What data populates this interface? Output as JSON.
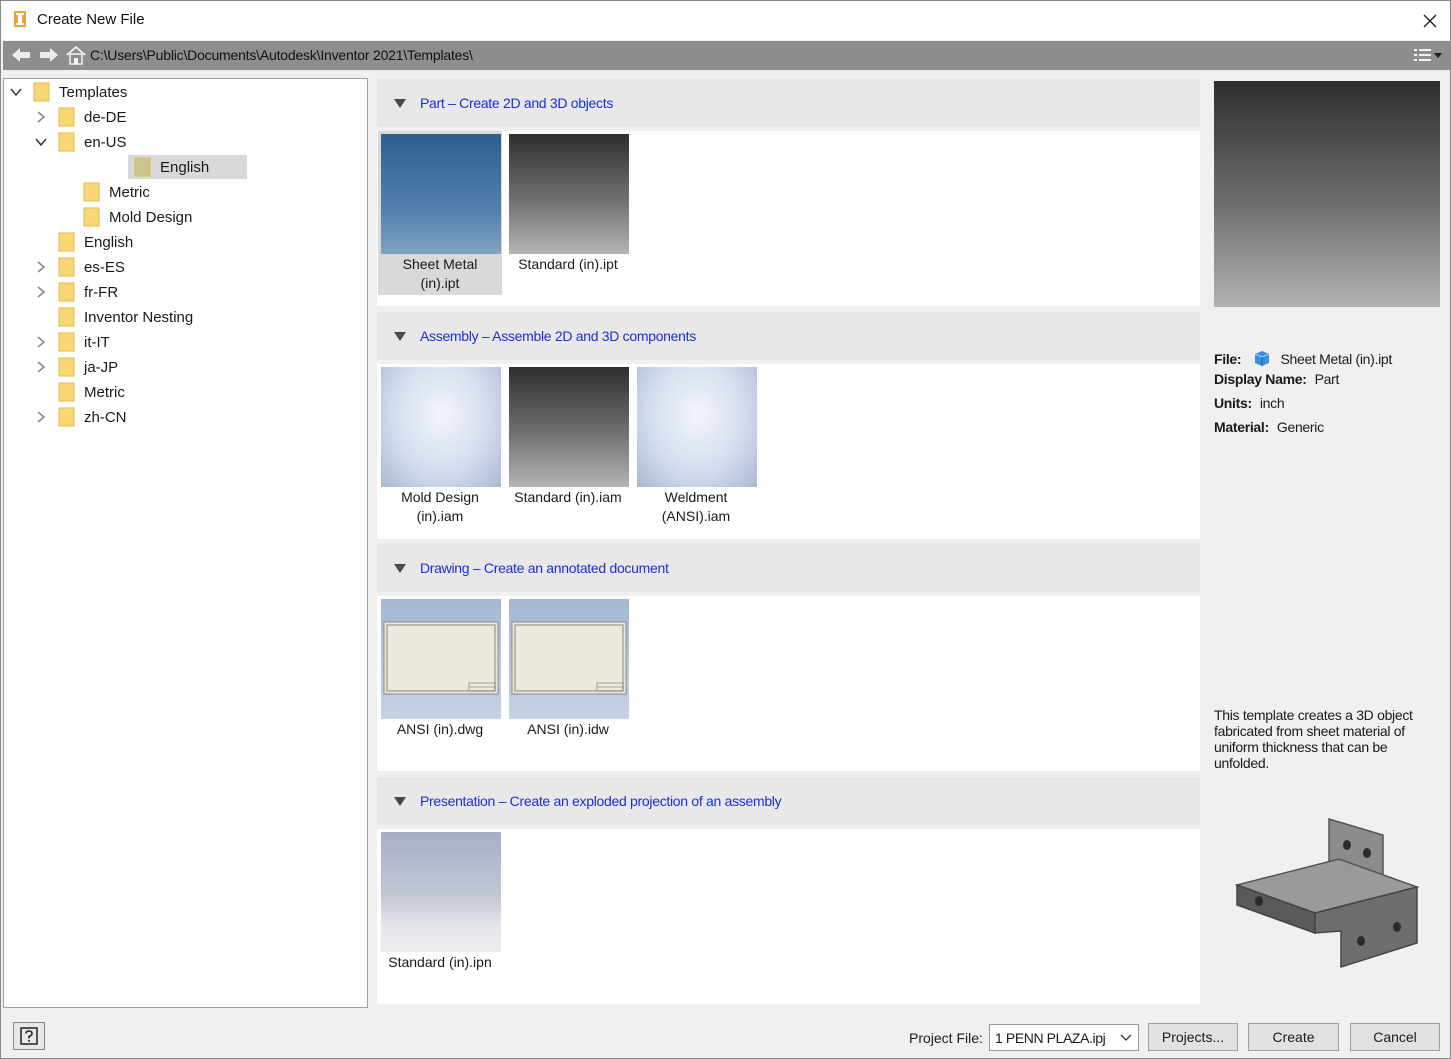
{
  "window": {
    "title": "Create New File"
  },
  "pathbar": {
    "path": "C:\\Users\\Public\\Documents\\Autodesk\\Inventor 2021\\Templates\\"
  },
  "tree": {
    "items": [
      {
        "label": "Templates",
        "expander": "expanded"
      },
      {
        "label": "de-DE",
        "expander": "collapsed"
      },
      {
        "label": "en-US",
        "expander": "expanded"
      },
      {
        "label": "English",
        "expander": "none",
        "selected": true
      },
      {
        "label": "Metric",
        "expander": "none"
      },
      {
        "label": "Mold Design",
        "expander": "none"
      },
      {
        "label": "English",
        "expander": "none"
      },
      {
        "label": "es-ES",
        "expander": "collapsed"
      },
      {
        "label": "fr-FR",
        "expander": "collapsed"
      },
      {
        "label": "Inventor Nesting",
        "expander": "none"
      },
      {
        "label": "it-IT",
        "expander": "collapsed"
      },
      {
        "label": "ja-JP",
        "expander": "collapsed"
      },
      {
        "label": "Metric",
        "expander": "none"
      },
      {
        "label": "zh-CN",
        "expander": "collapsed"
      }
    ]
  },
  "sections": [
    {
      "label": "Part – Create 2D and 3D objects",
      "templates": [
        {
          "line1": "Sheet Metal",
          "line2": "(in).ipt",
          "thumb": "blue-gradient",
          "selected": true
        },
        {
          "line1": "Standard (in).ipt",
          "line2": "",
          "thumb": "dark-gradient"
        }
      ]
    },
    {
      "label": "Assembly – Assemble 2D and 3D components",
      "templates": [
        {
          "line1": "Mold Design",
          "line2": "(in).iam",
          "thumb": "pale-gradient"
        },
        {
          "line1": "Standard (in).iam",
          "line2": "",
          "thumb": "dark-gradient"
        },
        {
          "line1": "Weldment",
          "line2": "(ANSI).iam",
          "thumb": "pale-gradient"
        }
      ]
    },
    {
      "label": "Drawing – Create an annotated document",
      "templates": [
        {
          "line1": "ANSI (in).dwg",
          "line2": "",
          "thumb": "drawing-sheet"
        },
        {
          "line1": "ANSI (in).idw",
          "line2": "",
          "thumb": "drawing-sheet"
        }
      ]
    },
    {
      "label": "Presentation – Create an exploded projection of an assembly",
      "templates": [
        {
          "line1": "Standard (in).ipn",
          "line2": "",
          "thumb": "presentation-gradient"
        }
      ]
    }
  ],
  "info": {
    "file_label": "File:",
    "file_value": "Sheet Metal (in).ipt",
    "display_name_label": "Display Name:",
    "display_name_value": "Part",
    "units_label": "Units:",
    "units_value": "inch",
    "material_label": "Material:",
    "material_value": "Generic",
    "description": "This template creates a 3D object fabricated from sheet material of uniform thickness that can be unfolded."
  },
  "footer": {
    "project_file_label": "Project File:",
    "project_file_value": "1 PENN PLAZA.ipj",
    "projects_button": "Projects...",
    "create_button": "Create",
    "cancel_button": "Cancel"
  },
  "colors": {
    "link_blue": "#1a2fd9",
    "folder_yellow": "#f8d775",
    "path_bar": "#8e8e8e",
    "selection": "#d9d9d9"
  },
  "icons": {
    "app": "inventor-app-icon",
    "close": "close-icon",
    "back": "back-arrow-icon",
    "forward": "forward-arrow-icon",
    "home": "home-icon",
    "view": "view-options-icon",
    "folder": "folder-icon",
    "help": "help-icon",
    "file_type": "part-file-icon"
  }
}
